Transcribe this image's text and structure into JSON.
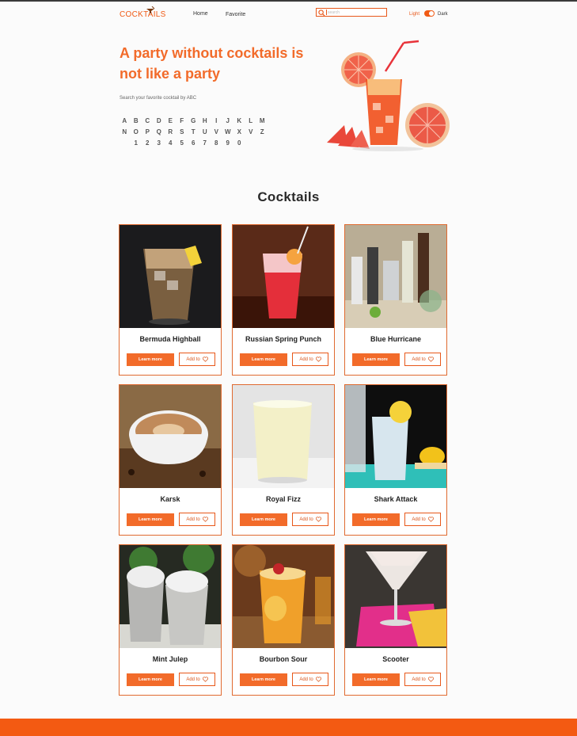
{
  "header": {
    "logo": "COCKTAILS",
    "nav": [
      "Home",
      "Favorite"
    ],
    "search_placeholder": "search",
    "theme_light": "Light",
    "theme_dark": "Dark"
  },
  "hero": {
    "title": "A party without cocktails is not like a party",
    "subtitle": "Search your favorite cocktail by ABC",
    "letters_row1": [
      "A",
      "B",
      "C",
      "D",
      "E",
      "F",
      "G",
      "H",
      "I",
      "J",
      "K",
      "L",
      "M"
    ],
    "letters_row2": [
      "N",
      "O",
      "P",
      "Q",
      "R",
      "S",
      "T",
      "U",
      "V",
      "W",
      "X",
      "V",
      "Z"
    ],
    "digits": [
      "1",
      "2",
      "3",
      "4",
      "5",
      "6",
      "7",
      "8",
      "9",
      "0"
    ]
  },
  "section": {
    "title": "Cocktails"
  },
  "buttons": {
    "learn": "Learn more",
    "add": "Add to"
  },
  "cards": [
    {
      "name": "Bermuda Highball"
    },
    {
      "name": "Russian Spring Punch"
    },
    {
      "name": "Blue Hurricane"
    },
    {
      "name": "Karsk"
    },
    {
      "name": "Royal Fizz"
    },
    {
      "name": "Shark Attack"
    },
    {
      "name": "Mint Julep"
    },
    {
      "name": "Bourbon Sour"
    },
    {
      "name": "Scooter"
    }
  ],
  "colors": {
    "accent": "#f26b2a",
    "footer": "#f35a12"
  }
}
